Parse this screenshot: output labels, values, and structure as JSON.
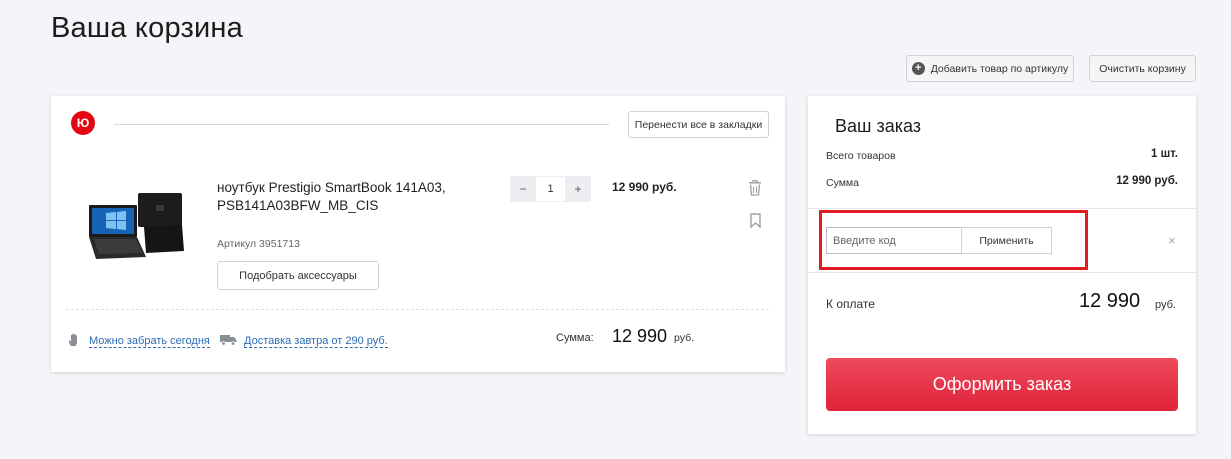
{
  "page": {
    "title": "Ваша корзина"
  },
  "toolbar": {
    "add_by_article_label": "Добавить товар по артикулу",
    "clear_cart_label": "Очистить корзину"
  },
  "cart": {
    "shop_logo_text": "Ю",
    "move_to_bookmarks_label": "Перенести все в закладки",
    "item": {
      "name": "ноутбук Prestigio SmartBook 141A03, PSB141A03BFW_MB_CIS",
      "article": "Артикул 3951713",
      "accessories_label": "Подобрать аксессуары",
      "quantity": "1",
      "minus": "−",
      "plus": "+",
      "price": "12 990 руб."
    },
    "pickup_link": "Можно забрать сегодня",
    "delivery_link": "Доставка завтра от 290 руб.",
    "sum_label": "Сумма:",
    "sum_value": "12 990",
    "sum_currency": "руб."
  },
  "order": {
    "title": "Ваш заказ",
    "total_items_label": "Всего товаров",
    "total_items_value": "1 шт.",
    "sum_label": "Сумма",
    "sum_value": "12 990 руб.",
    "promo_placeholder": "Введите код",
    "apply_label": "Применить",
    "close_glyph": "×",
    "pay_label": "К оплате",
    "pay_value": "12 990",
    "pay_currency": "руб.",
    "checkout_label": "Оформить заказ"
  },
  "colors": {
    "accent": "#e0233a",
    "link": "#2b6cb5",
    "highlight": "#e01b24",
    "background": "#f3f5f8"
  }
}
